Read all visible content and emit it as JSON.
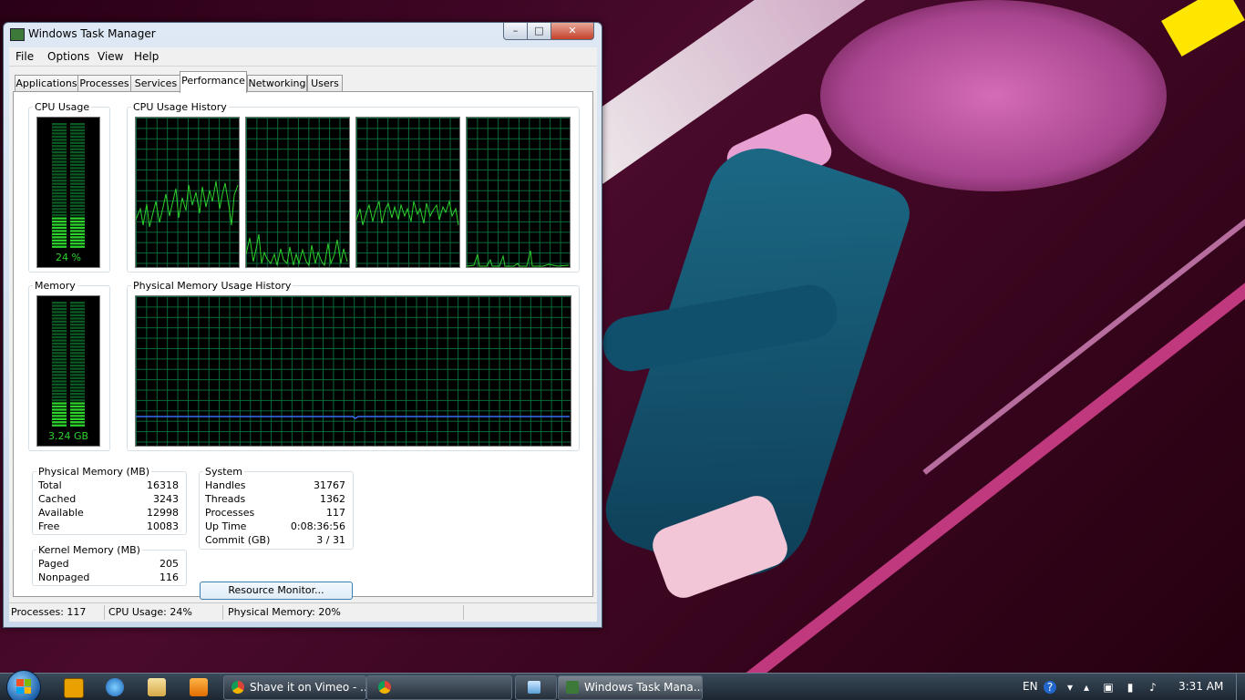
{
  "window": {
    "title": "Windows Task Manager",
    "controls": {
      "minimize": "–",
      "maximize": "□",
      "close": "✕"
    }
  },
  "menu": [
    "File",
    "Options",
    "View",
    "Help"
  ],
  "tabs": [
    "Applications",
    "Processes",
    "Services",
    "Performance",
    "Networking",
    "Users"
  ],
  "active_tab": "Performance",
  "cpu": {
    "usage_label": "CPU Usage",
    "usage_value": "24 %",
    "usage_fraction": 0.24,
    "history_label": "CPU Usage History"
  },
  "memory": {
    "label": "Memory",
    "value": "3.24 GB",
    "usage_fraction": 0.2,
    "history_label": "Physical Memory Usage History"
  },
  "physical_memory": {
    "title": "Physical Memory (MB)",
    "rows": [
      {
        "label": "Total",
        "value": "16318"
      },
      {
        "label": "Cached",
        "value": "3243"
      },
      {
        "label": "Available",
        "value": "12998"
      },
      {
        "label": "Free",
        "value": "10083"
      }
    ]
  },
  "kernel_memory": {
    "title": "Kernel Memory (MB)",
    "rows": [
      {
        "label": "Paged",
        "value": "205"
      },
      {
        "label": "Nonpaged",
        "value": "116"
      }
    ]
  },
  "system": {
    "title": "System",
    "rows": [
      {
        "label": "Handles",
        "value": "31767"
      },
      {
        "label": "Threads",
        "value": "1362"
      },
      {
        "label": "Processes",
        "value": "117"
      },
      {
        "label": "Up Time",
        "value": "0:08:36:56"
      },
      {
        "label": "Commit (GB)",
        "value": "3 / 31"
      }
    ]
  },
  "resource_monitor_button": "Resource Monitor...",
  "statusbar": {
    "processes": "Processes: 117",
    "cpu": "CPU Usage: 24%",
    "memory": "Physical Memory: 20%"
  },
  "taskbar": {
    "items": [
      {
        "label": "Shave it on Vimeo - ...",
        "icon": "chrome-icon"
      },
      {
        "label": "",
        "icon": "chrome-icon"
      },
      {
        "label": "",
        "icon": "network-icon"
      },
      {
        "label": "Windows Task Mana...",
        "icon": "task-manager-icon"
      }
    ],
    "language": "EN",
    "clock": "3:31 AM"
  },
  "colors": {
    "graph_green": "#2dd32d",
    "grid_green": "#0a6a3a",
    "memory_line": "#3a6cf0"
  }
}
